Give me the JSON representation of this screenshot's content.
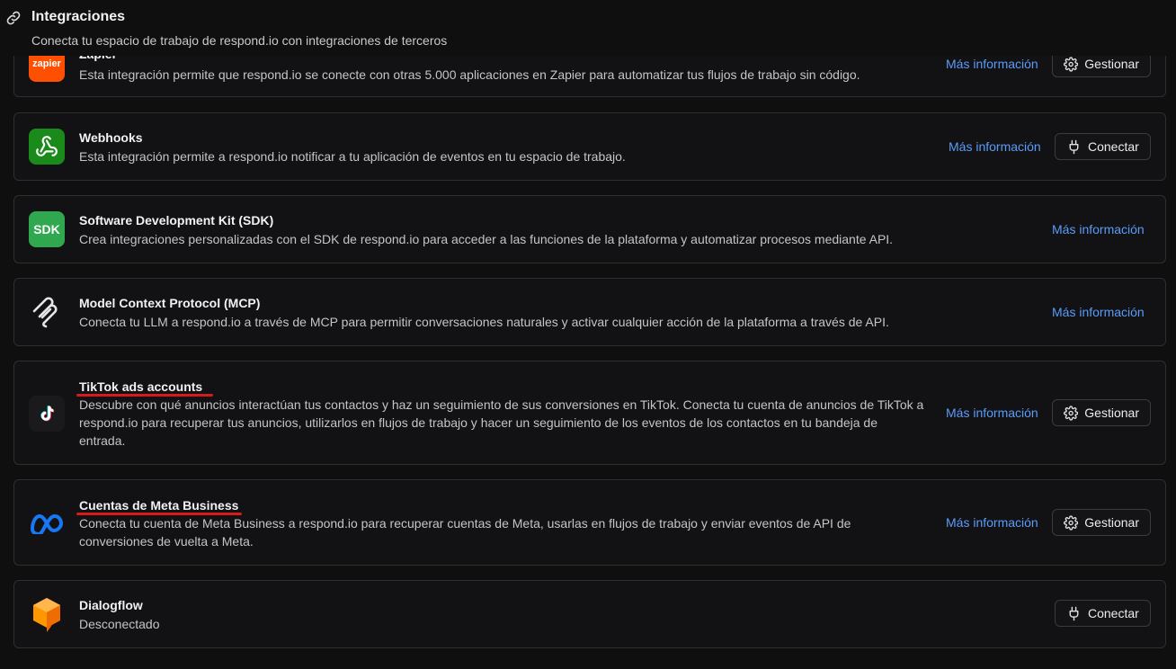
{
  "header": {
    "title": "Integraciones",
    "subtitle": "Conecta tu espacio de trabajo de respond.io con integraciones de terceros"
  },
  "integrations": [
    {
      "name": "Zapier",
      "logo_text": "zapier",
      "description": "Esta integración permite que respond.io se conecte con otras 5.000 aplicaciones en Zapier para automatizar tus flujos de trabajo sin código.",
      "more": "Más información",
      "action": "Gestionar"
    },
    {
      "name": "Webhooks",
      "description": "Esta integración permite a respond.io notificar a tu aplicación de eventos en tu espacio de trabajo.",
      "more": "Más información",
      "action": "Conectar"
    },
    {
      "name": "Software Development Kit (SDK)",
      "logo_text": "SDK",
      "description": "Crea integraciones personalizadas con el SDK de respond.io para acceder a las funciones de la plataforma y automatizar procesos mediante API.",
      "more": "Más información"
    },
    {
      "name": "Model Context Protocol (MCP)",
      "description": "Conecta tu LLM a respond.io a través de MCP para permitir conversaciones naturales y activar cualquier acción de la plataforma a través de API.",
      "more": "Más información"
    },
    {
      "name": "TikTok ads accounts",
      "description": "Descubre con qué anuncios interactúan tus contactos y haz un seguimiento de sus conversiones en TikTok. Conecta tu cuenta de anuncios de TikTok a respond.io para recuperar tus anuncios, utilizarlos en flujos de trabajo y hacer un seguimiento de los eventos de los contactos en tu bandeja de entrada.",
      "more": "Más información",
      "action": "Gestionar"
    },
    {
      "name": "Cuentas de Meta Business",
      "description": "Conecta tu cuenta de Meta Business a respond.io para recuperar cuentas de Meta, usarlas en flujos de trabajo y enviar eventos de API de conversiones de vuelta a Meta.",
      "more": "Más información",
      "action": "Gestionar"
    },
    {
      "name": "Dialogflow",
      "description": "Desconectado",
      "action": "Conectar"
    }
  ],
  "colors": {
    "link": "#5a9cf8",
    "annotation": "#d71a1a",
    "zapier": "#ff4f00",
    "webhooks": "#1a8a1a",
    "sdk": "#2fa84f",
    "meta": "#1877f2",
    "dialogflow": "#ff9800"
  }
}
